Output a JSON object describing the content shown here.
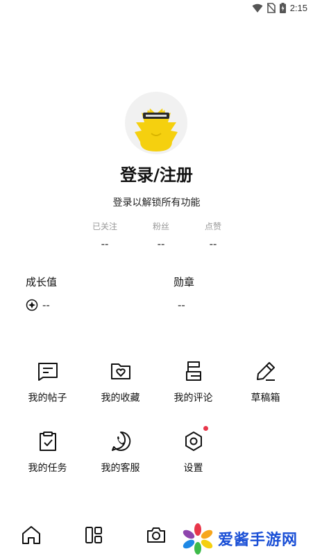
{
  "status_bar": {
    "time": "2:15"
  },
  "profile": {
    "title": "登录/注册",
    "subtitle": "登录以解锁所有功能"
  },
  "stats": [
    {
      "label": "已关注",
      "value": "--"
    },
    {
      "label": "粉丝",
      "value": "--"
    },
    {
      "label": "点赞",
      "value": "--"
    }
  ],
  "growth": {
    "label": "成长值",
    "value": "--"
  },
  "medal": {
    "label": "勋章",
    "value": "--"
  },
  "menu": [
    {
      "label": "我的帖子",
      "icon": "post-icon"
    },
    {
      "label": "我的收藏",
      "icon": "favorite-folder-icon"
    },
    {
      "label": "我的评论",
      "icon": "comment-icon"
    },
    {
      "label": "草稿箱",
      "icon": "pencil-icon"
    },
    {
      "label": "我的任务",
      "icon": "task-clipboard-icon"
    },
    {
      "label": "我的客服",
      "icon": "phone-icon"
    },
    {
      "label": "设置",
      "icon": "settings-hexagon-icon"
    }
  ],
  "bottom_nav": [
    {
      "icon": "home-icon"
    },
    {
      "icon": "layout-icon"
    },
    {
      "icon": "camera-icon"
    }
  ],
  "watermark": {
    "text": "爱酱手游网"
  },
  "colors": {
    "badge": "#e8364a",
    "avatar_yellow": "#f5d00f",
    "watermark_blue": "#1a4fd6"
  }
}
